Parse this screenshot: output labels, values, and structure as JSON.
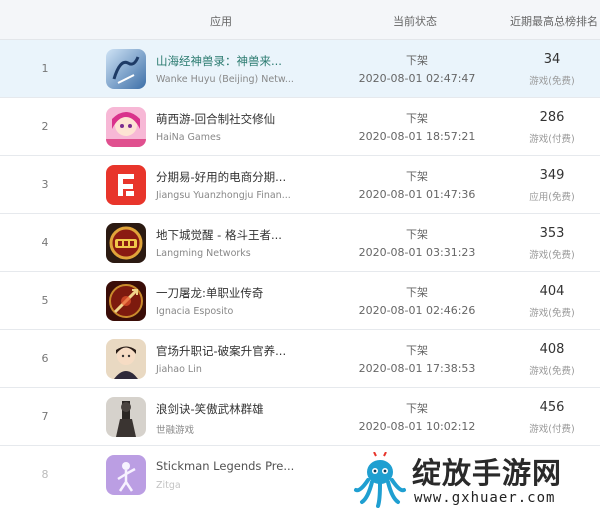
{
  "header": {
    "app_col": "应用",
    "status_col": "当前状态",
    "peak_col": "近期最高总榜排名"
  },
  "rows": [
    {
      "rank": "1",
      "name": "山海经神兽录：神兽来...",
      "developer": "Wanke Huyu (Beijing) Netw...",
      "status": "下架",
      "time": "2020-08-01 02:47:47",
      "peak": "34",
      "category": "游戏(免费)",
      "icon": "shanhai-game-icon"
    },
    {
      "rank": "2",
      "name": "萌西游-回合制社交修仙",
      "developer": "HaiNa Games",
      "status": "下架",
      "time": "2020-08-01 18:57:21",
      "peak": "286",
      "category": "游戏(付费)",
      "icon": "mengxiyou-game-icon"
    },
    {
      "rank": "3",
      "name": "分期易-好用的电商分期...",
      "developer": "Jiangsu Yuanzhongju Finan...",
      "status": "下架",
      "time": "2020-08-01 01:47:36",
      "peak": "349",
      "category": "应用(免费)",
      "icon": "fenqiyi-app-icon"
    },
    {
      "rank": "4",
      "name": "地下城觉醒 - 格斗王者...",
      "developer": "Langming Networks",
      "status": "下架",
      "time": "2020-08-01 03:31:23",
      "peak": "353",
      "category": "游戏(免费)",
      "icon": "dungeon-555-game-icon"
    },
    {
      "rank": "5",
      "name": "一刀屠龙:单职业传奇",
      "developer": "Ignacia Esposito",
      "status": "下架",
      "time": "2020-08-01 02:46:26",
      "peak": "404",
      "category": "游戏(免费)",
      "icon": "dragon-blade-game-icon"
    },
    {
      "rank": "6",
      "name": "官场升职记-破案升官养...",
      "developer": "Jiahao Lin",
      "status": "下架",
      "time": "2020-08-01 17:38:53",
      "peak": "408",
      "category": "游戏(免费)",
      "icon": "officer-game-icon"
    },
    {
      "rank": "7",
      "name": "浪剑诀-笑傲武林群雄",
      "developer": "世融游戏",
      "status": "下架",
      "time": "2020-08-01 10:02:12",
      "peak": "456",
      "category": "游戏(付费)",
      "icon": "langjianjue-game-icon"
    },
    {
      "rank": "8",
      "name": "Stickman Legends Pre...",
      "developer": "Zitga",
      "status": "",
      "time": "",
      "peak": "",
      "category": "",
      "icon": "stickman-game-icon"
    }
  ],
  "watermark": {
    "title": "绽放手游网",
    "url": "www.gxhuaer.com"
  },
  "colors": {
    "header_bg": "#f4f6f9",
    "selected_row_bg": "#eaf4fb",
    "selected_name": "#2a7a6f"
  }
}
